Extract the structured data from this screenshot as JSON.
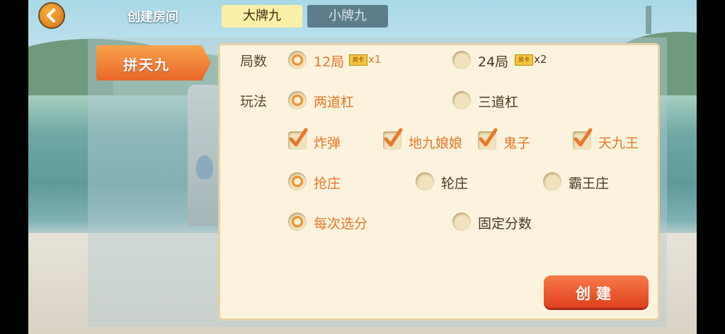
{
  "header": {
    "title": "创建房间"
  },
  "tabs": [
    {
      "label": "大牌九",
      "active": true
    },
    {
      "label": "小牌九",
      "active": false
    }
  ],
  "sidebar": {
    "items": [
      {
        "label": "拼天九",
        "active": true
      }
    ]
  },
  "form": {
    "rounds_label": "局数",
    "rounds": [
      {
        "label": "12局",
        "badge": "房卡",
        "mult": "x1",
        "selected": true
      },
      {
        "label": "24局",
        "badge": "房卡",
        "mult": "x2",
        "selected": false
      }
    ],
    "play_label": "玩法",
    "bars": [
      {
        "label": "两道杠",
        "selected": true
      },
      {
        "label": "三道杠",
        "selected": false
      }
    ],
    "extras": [
      {
        "label": "炸弹",
        "checked": true
      },
      {
        "label": "地九娘娘",
        "checked": true
      },
      {
        "label": "鬼子",
        "checked": true
      },
      {
        "label": "天九王",
        "checked": true
      }
    ],
    "banker": [
      {
        "label": "抢庄",
        "selected": true
      },
      {
        "label": "轮庄",
        "selected": false
      },
      {
        "label": "霸王庄",
        "selected": false
      }
    ],
    "scoring": [
      {
        "label": "每次选分",
        "selected": true
      },
      {
        "label": "固定分数",
        "selected": false
      }
    ]
  },
  "create_button": {
    "label": "创建"
  },
  "colors": {
    "accent": "#e9772b",
    "panel": "#fbf3de",
    "button": "#e0401f"
  }
}
